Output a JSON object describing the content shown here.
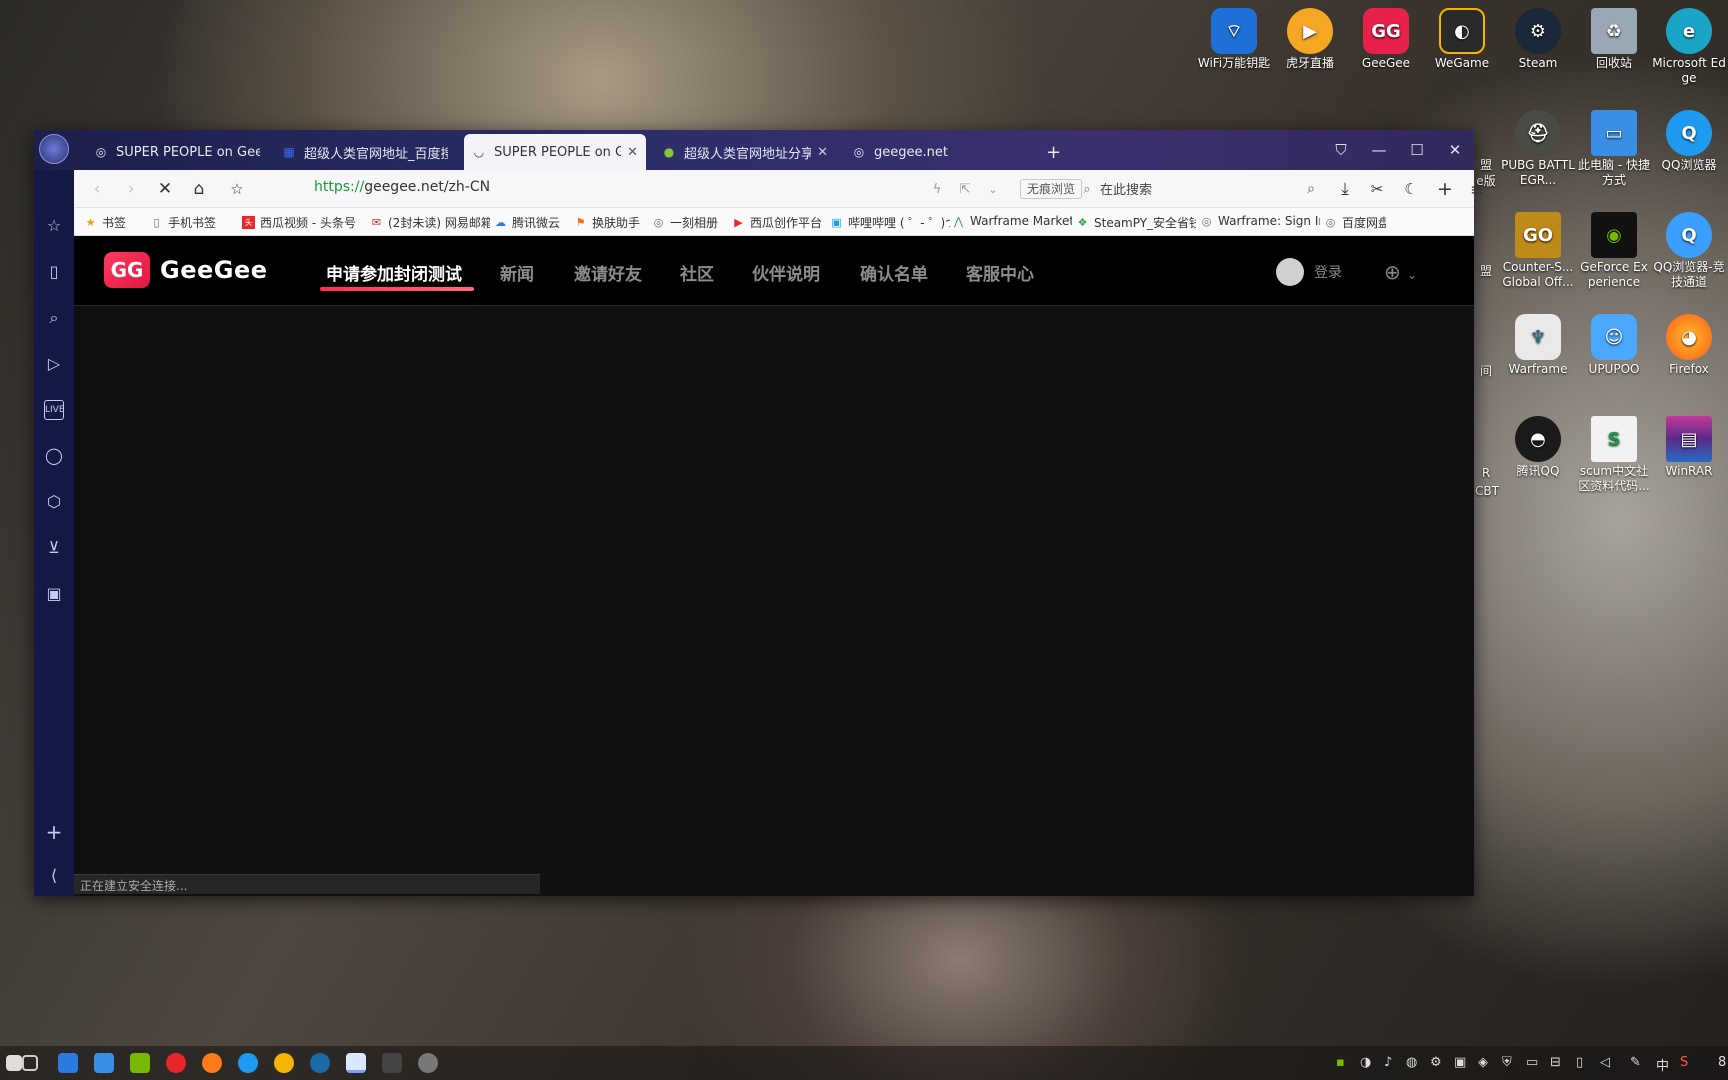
{
  "desktop": {
    "icons": [
      {
        "id": "wifi",
        "label": "WiFi万能钥匙",
        "color": "#1f6fd8"
      },
      {
        "id": "huya",
        "label": "虎牙直播",
        "color": "#f5a623"
      },
      {
        "id": "geegee",
        "label": "GeeGee",
        "color": "#e8214a"
      },
      {
        "id": "wegame",
        "label": "WeGame",
        "color": "#2a2a2a"
      },
      {
        "id": "steam",
        "label": "Steam",
        "color": "#1b2838"
      },
      {
        "id": "recycle",
        "label": "回收站",
        "color": "#9aa7b4"
      },
      {
        "id": "edge",
        "label": "Microsoft Edge",
        "color": "#1aa5c8"
      },
      {
        "id": "pubg",
        "label": "PUBG BATTLEGR...",
        "color": "#4a4a46"
      },
      {
        "id": "thispc",
        "label": "此电脑 - 快捷方式",
        "color": "#3a8ee6"
      },
      {
        "id": "qqbrowser",
        "label": "QQ浏览器",
        "color": "#1e9bf0"
      },
      {
        "id": "csgo",
        "label": "Counter-S... Global Off...",
        "color": "#c08a1a"
      },
      {
        "id": "geforce",
        "label": "GeForce Experience",
        "color": "#76b900"
      },
      {
        "id": "qqbrowser2",
        "label": "QQ浏览器-竞技通道",
        "color": "#3aa0ff"
      },
      {
        "id": "warframe",
        "label": "Warframe",
        "color": "#e9e9e9"
      },
      {
        "id": "upupoo",
        "label": "UPUPOO",
        "color": "#4aa8ff"
      },
      {
        "id": "firefox",
        "label": "Firefox",
        "color": "#ff7a1a"
      },
      {
        "id": "qq",
        "label": "腾讯QQ",
        "color": "#1a1a1a"
      },
      {
        "id": "scum",
        "label": "scum中文社区资料代码...",
        "color": "#f2f2f2"
      },
      {
        "id": "winrar",
        "label": "WinRAR",
        "color": "#8a2a7a"
      }
    ],
    "partial_labels": {
      "l1": "盟",
      "l2": "e版",
      "l3": "盟",
      "l4": "间",
      "l5": "R",
      "l6": "CBT"
    }
  },
  "browser": {
    "tabs": [
      {
        "title": "SUPER PEOPLE on GeeG",
        "icon": "globe-icon",
        "active": false
      },
      {
        "title": "超级人类官网地址_百度搜索",
        "icon": "baidu-icon",
        "active": false
      },
      {
        "title": "SUPER PEOPLE on Gee",
        "icon": "loading-icon",
        "active": true
      },
      {
        "title": "超级人类官网地址分享_这",
        "icon": "site-icon",
        "active": false
      },
      {
        "title": "geegee.net",
        "icon": "globe-icon",
        "active": false
      }
    ],
    "new_tab": "+",
    "url_scheme": "https://",
    "url_rest": "geegee.net/zh-CN",
    "incognito_label": "无痕浏览",
    "search_placeholder": "在此搜索",
    "bookmarks": [
      {
        "label": "书签",
        "icon": "star-icon",
        "color": "#f2a20a"
      },
      {
        "label": "手机书签",
        "icon": "phone-icon",
        "color": "#666"
      },
      {
        "label": "西瓜视频 - 头条号",
        "icon": "toutiao-icon",
        "color": "#e8262a"
      },
      {
        "label": "(2封未读) 网易邮箱",
        "icon": "mail-icon",
        "color": "#d2262a"
      },
      {
        "label": "腾讯微云",
        "icon": "cloud-icon",
        "color": "#2a7ae2"
      },
      {
        "label": "换肤助手",
        "icon": "flag-icon",
        "color": "#ff6a00"
      },
      {
        "label": "一刻相册",
        "icon": "globe-icon",
        "color": "#666"
      },
      {
        "label": "西瓜创作平台",
        "icon": "play-icon",
        "color": "#e8262a"
      },
      {
        "label": "哔哩哔哩 ( ゜- ゜)つ",
        "icon": "bilibili-icon",
        "color": "#1aa0e0"
      },
      {
        "label": "Warframe Market",
        "icon": "wf-icon",
        "color": "#3a8aaa"
      },
      {
        "label": "SteamPY_安全省钱",
        "icon": "steampy-icon",
        "color": "#2aa84a"
      },
      {
        "label": "Warframe: Sign In",
        "icon": "globe-icon",
        "color": "#666"
      },
      {
        "label": "百度网盘",
        "icon": "globe-icon",
        "color": "#666"
      }
    ],
    "status_text": "正在建立安全连接..."
  },
  "site": {
    "logo_text": "GG",
    "brand": "GeeGee",
    "nav": [
      {
        "label": "申请参加封闭测试",
        "active": true
      },
      {
        "label": "新闻",
        "active": false
      },
      {
        "label": "邀请好友",
        "active": false
      },
      {
        "label": "社区",
        "active": false
      },
      {
        "label": "伙伴说明",
        "active": false
      },
      {
        "label": "确认名单",
        "active": false
      },
      {
        "label": "客服中心",
        "active": false
      }
    ],
    "login_label": "登录"
  },
  "taskbar": {
    "ime": "中",
    "clock_partial": "8"
  },
  "colors": {
    "accent": "#ff2d55",
    "titlebar": "#2b2e6a",
    "rail": "#141845",
    "page_bg": "#101010"
  }
}
